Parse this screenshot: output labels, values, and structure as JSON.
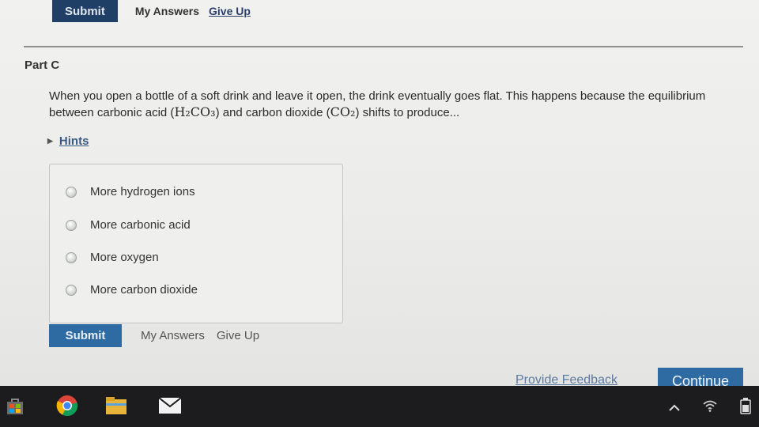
{
  "top_bar": {
    "submit_label": "Submit",
    "my_answers_label": "My Answers",
    "give_up_label": "Give Up"
  },
  "part": {
    "title": "Part C"
  },
  "question": {
    "text_1": "When you open a bottle of a soft drink and leave it open, the drink eventually goes flat. This happens because the equilibrium between carbonic acid (",
    "formula_1": "H₂CO₃",
    "text_2": ") and carbon dioxide (",
    "formula_2": "CO₂",
    "text_3": ") shifts to produce..."
  },
  "hints": {
    "label": "Hints"
  },
  "options": [
    {
      "label": "More hydrogen ions"
    },
    {
      "label": "More carbonic acid"
    },
    {
      "label": "More oxygen"
    },
    {
      "label": "More carbon dioxide"
    }
  ],
  "bottom_bar": {
    "submit_label": "Submit",
    "my_answers_label": "My Answers",
    "give_up_label": "Give Up"
  },
  "footer": {
    "feedback_label": "Provide Feedback",
    "continue_label": "Continue"
  },
  "taskbar": {
    "icons": [
      "store-icon",
      "chrome-icon",
      "folder-icon",
      "mail-icon"
    ],
    "tray_icons": [
      "chevron-up-icon",
      "wifi-icon",
      "battery-icon"
    ]
  },
  "colors": {
    "submit_top": "#1f3f66",
    "submit": "#2f6ba3",
    "continue": "#2f6ba3",
    "link": "#3a5a85"
  }
}
